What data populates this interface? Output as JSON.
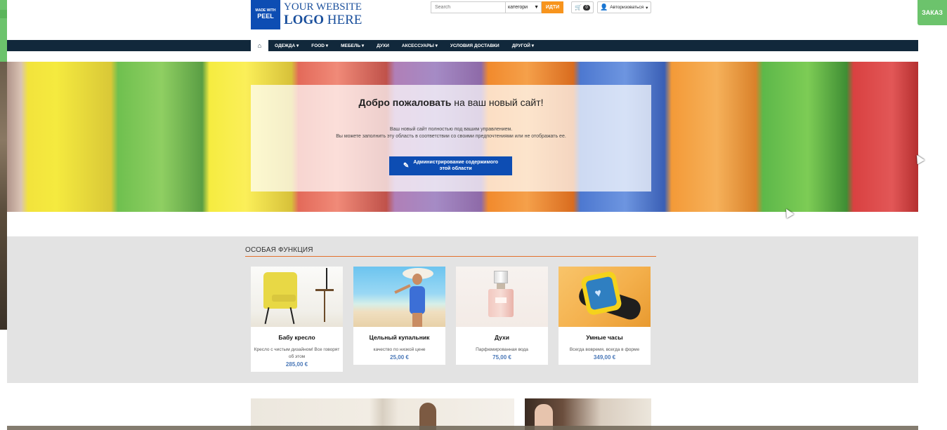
{
  "side": {
    "order_label": "ЗАКАЗ"
  },
  "logo": {
    "badge_top": "MADE WITH",
    "badge_brand": "PEEL",
    "line1": "YOUR WEBSITE",
    "line2_bold": "LOGO",
    "line2_rest": " HERE"
  },
  "search": {
    "placeholder": "Search",
    "category_value": "категори",
    "go_label": "ИДТИ"
  },
  "cart": {
    "count": "0"
  },
  "login": {
    "label": "Авторизоваться"
  },
  "nav": {
    "items": [
      {
        "label": "ОДЕЖДА ▾"
      },
      {
        "label": "FOOD ▾"
      },
      {
        "label": "МЕБЕЛЬ ▾"
      },
      {
        "label": "ДУХИ"
      },
      {
        "label": "АКСЕССУАРЫ ▾"
      },
      {
        "label": "УСЛОВИЯ ДОСТАВКИ"
      },
      {
        "label": "ДРУГОЙ ▾"
      }
    ]
  },
  "hero": {
    "title_bold": "Добро пожаловать",
    "title_rest": " на ваш новый сайт!",
    "desc_line1": "Ваш новый сайт полностью под вашим управлением.",
    "desc_line2": "Вы можете заполнить эту область в соответствии со своими предпочтениями или не отображать ее.",
    "button_line1": "Администрирование содержимого",
    "button_line2": "этой области"
  },
  "featured": {
    "title": "ОСОБАЯ ФУНКЦИЯ",
    "accent_color": "#e3702d",
    "products": [
      {
        "name": "Бабу кресло",
        "desc": "Кресло с чистым дизайном! Все говорят об этом",
        "price": "285,00 €"
      },
      {
        "name": "Цельный купальник",
        "desc": "качество по низкой цене",
        "price": "25,00 €"
      },
      {
        "name": "Духи",
        "desc": "Парфюмированная вода",
        "price": "75,00 €"
      },
      {
        "name": "Умные часы",
        "desc": "Всегда вовремя, всегда в форме",
        "price": "349,00 €"
      }
    ]
  },
  "colors": {
    "brand_blue": "#0d4db3",
    "nav_bg": "#11283b",
    "go_orange": "#f7941d",
    "side_green": "#6cc36c",
    "price_blue": "#4a78b8"
  }
}
